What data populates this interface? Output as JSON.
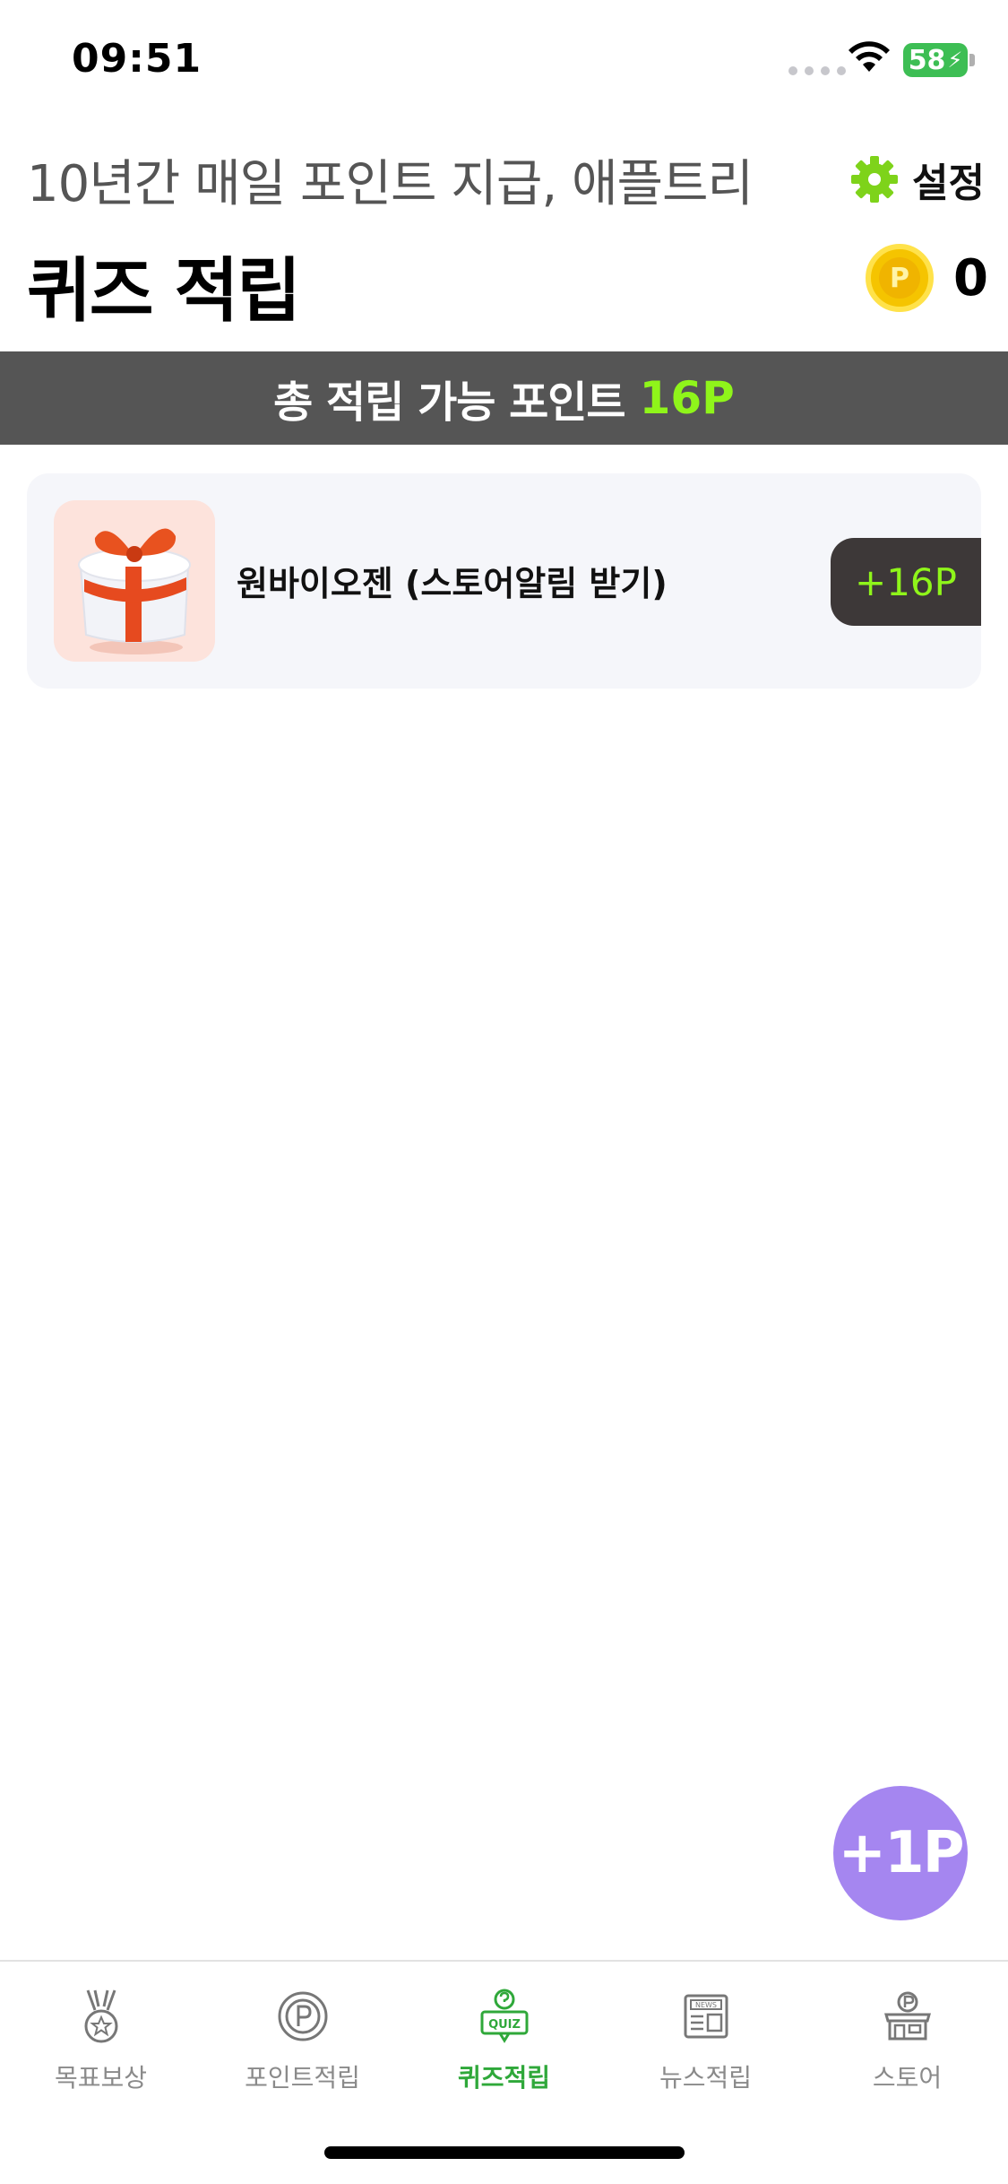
{
  "status_bar": {
    "time": "09:51",
    "battery": "58"
  },
  "header": {
    "subtitle": "10년간 매일 포인트 지급, 애플트리",
    "settings_label": "설정",
    "title": "퀴즈 적립",
    "point_balance": "0",
    "coin_symbol": "P"
  },
  "banner": {
    "label": "총 적립 가능 포인트",
    "value": "16P"
  },
  "items": [
    {
      "title": "원바이오젠 (스토어알림 받기)",
      "reward": "+16P"
    }
  ],
  "fab": {
    "label": "+1P"
  },
  "tabs": [
    {
      "label": "목표보상",
      "icon": "medal-icon"
    },
    {
      "label": "포인트적립",
      "icon": "point-coin-icon"
    },
    {
      "label": "퀴즈적립",
      "icon": "quiz-icon",
      "active": true
    },
    {
      "label": "뉴스적립",
      "icon": "news-icon"
    },
    {
      "label": "스토어",
      "icon": "store-icon"
    }
  ],
  "colors": {
    "accent_green": "#8ff51a",
    "active_tab": "#2fa83a",
    "banner_bg": "#555555",
    "fab_bg": "#a586f0",
    "pill_bg": "#3d3838"
  }
}
